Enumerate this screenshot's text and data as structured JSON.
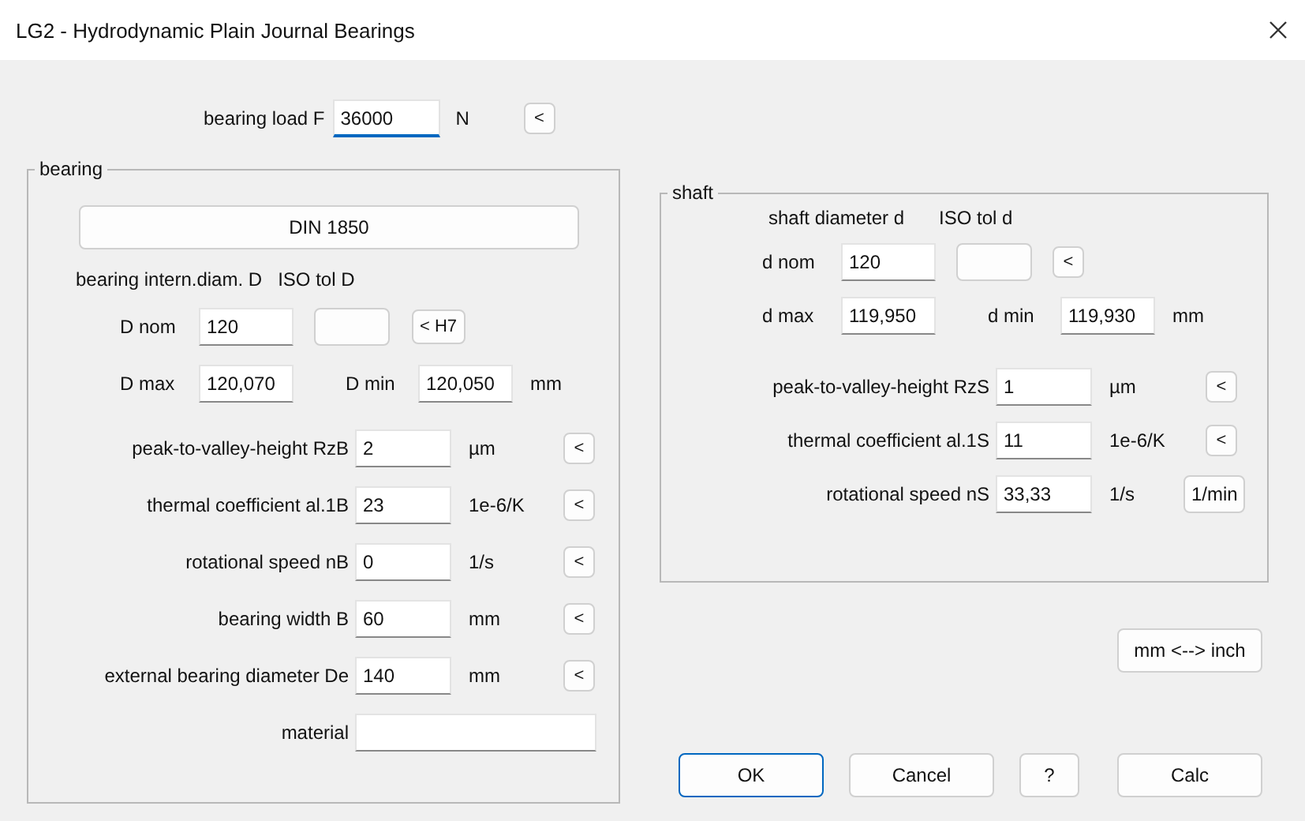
{
  "window": {
    "title": "LG2 - Hydrodynamic Plain Journal Bearings"
  },
  "bearing_load": {
    "label": "bearing load F",
    "value": "36000",
    "unit": "N",
    "button": "<",
    "focused": true
  },
  "bearing": {
    "title": "bearing",
    "standard_button": "DIN 1850",
    "diameter_heading": "bearing intern.diam. D",
    "tolerance_heading": "ISO tol D",
    "nom": {
      "label": "D nom",
      "value": "120"
    },
    "tolerance_button": "< H7",
    "max": {
      "label": "D max",
      "value": "120,070"
    },
    "min": {
      "label": "D min",
      "value": "120,050"
    },
    "unit": "mm",
    "rows": [
      {
        "label": "peak-to-valley-height RzB",
        "value": "2",
        "unit": "µm",
        "button": "<"
      },
      {
        "label": "thermal coefficient al.1B",
        "value": "23",
        "unit": "1e-6/K",
        "button": "<"
      },
      {
        "label": "rotational speed nB",
        "value": "0",
        "unit": "1/s",
        "button": "<"
      },
      {
        "label": "bearing width B",
        "value": "60",
        "unit": "mm",
        "button": "<"
      },
      {
        "label": "external bearing diameter De",
        "value": "140",
        "unit": "mm",
        "button": "<"
      }
    ],
    "material": {
      "label": "material"
    }
  },
  "shaft": {
    "title": "shaft",
    "diameter_heading": "shaft diameter d",
    "tolerance_heading": "ISO tol d",
    "nom": {
      "label": "d nom",
      "value": "120"
    },
    "tolerance_button": "<",
    "max": {
      "label": "d max",
      "value": "119,950"
    },
    "min": {
      "label": "d min",
      "value": "119,930"
    },
    "unit": "mm",
    "rows": [
      {
        "label": "peak-to-valley-height RzS",
        "value": "1",
        "unit": "µm",
        "button": "<"
      },
      {
        "label": "thermal coefficient al.1S",
        "value": "11",
        "unit": "1e-6/K",
        "button": "<"
      },
      {
        "label": "rotational speed nS",
        "value": "33,33",
        "unit": "1/s",
        "button": "1/min"
      }
    ]
  },
  "unit_button": "mm <--> inch",
  "buttons": [
    {
      "label": "OK",
      "default": true
    },
    {
      "label": "Cancel",
      "default": false
    },
    {
      "label": "?",
      "default": false
    },
    {
      "label": "Calc",
      "default": false
    }
  ]
}
